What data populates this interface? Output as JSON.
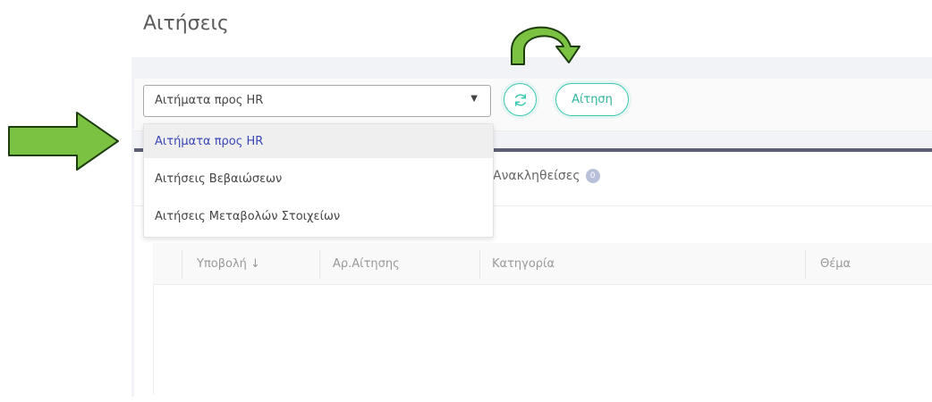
{
  "page": {
    "title": "Αιτήσεις"
  },
  "toolbar": {
    "select_value": "Αιτήματα προς HR",
    "refresh_icon": "refresh-icon",
    "request_button": "Αίτηση"
  },
  "dropdown": {
    "options": [
      {
        "label": "Αιτήματα προς HR",
        "selected": true
      },
      {
        "label": "Αιτήσεις Βεβαιώσεων",
        "selected": false
      },
      {
        "label": "Αιτήσεις Μεταβολών Στοιχείων",
        "selected": false
      }
    ]
  },
  "tabs": {
    "withdrawn": {
      "label": "Ανακληθείσες",
      "count": "0"
    }
  },
  "table": {
    "headers": [
      "Υποβολή ↓",
      "Αρ.Αίτησης",
      "Κατηγορία",
      "Θέμα"
    ]
  },
  "colors": {
    "accent_teal": "#3ac9b0",
    "selected_text": "#3a48b5",
    "annotation_green": "#7cc242",
    "tab_bar": "#5b5e74"
  }
}
